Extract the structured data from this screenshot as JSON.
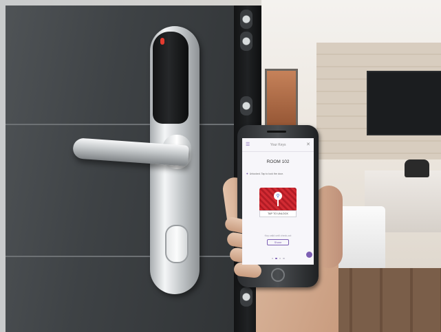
{
  "app": {
    "title": "Your Keys",
    "menu_icon": "menu-icon",
    "close_icon": "close-icon"
  },
  "room": {
    "title": "ROOM 102",
    "status": "Unlocked. Tap to lock the door."
  },
  "key_card": {
    "icon": "key-icon",
    "tap_label": "TAP TO UNLOCK"
  },
  "footer": {
    "info": "Key valid until check-out",
    "share_label": "Share"
  },
  "pager": {
    "pages": 4,
    "active": 1
  },
  "colors": {
    "accent": "#7d5fb3",
    "card_red": "#d22b33",
    "lock_led": "#e33b2f"
  }
}
